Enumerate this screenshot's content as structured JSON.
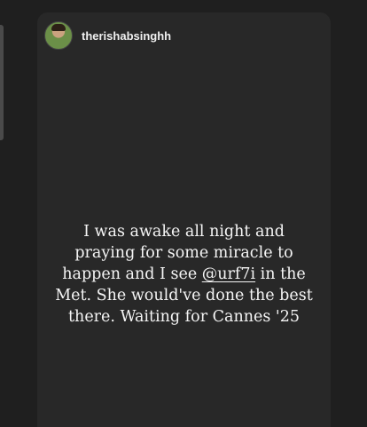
{
  "story": {
    "username": "therishabsinghh",
    "lines": {
      "l1": "I was awake all night and",
      "l2": "praying for some miracle to",
      "l3_pre": "happen and I see ",
      "l3_mention": "@urf7i",
      "l3_post": " in the",
      "l4": "Met. She would've done the best",
      "l5": "there. Waiting for Cannes '25"
    }
  }
}
